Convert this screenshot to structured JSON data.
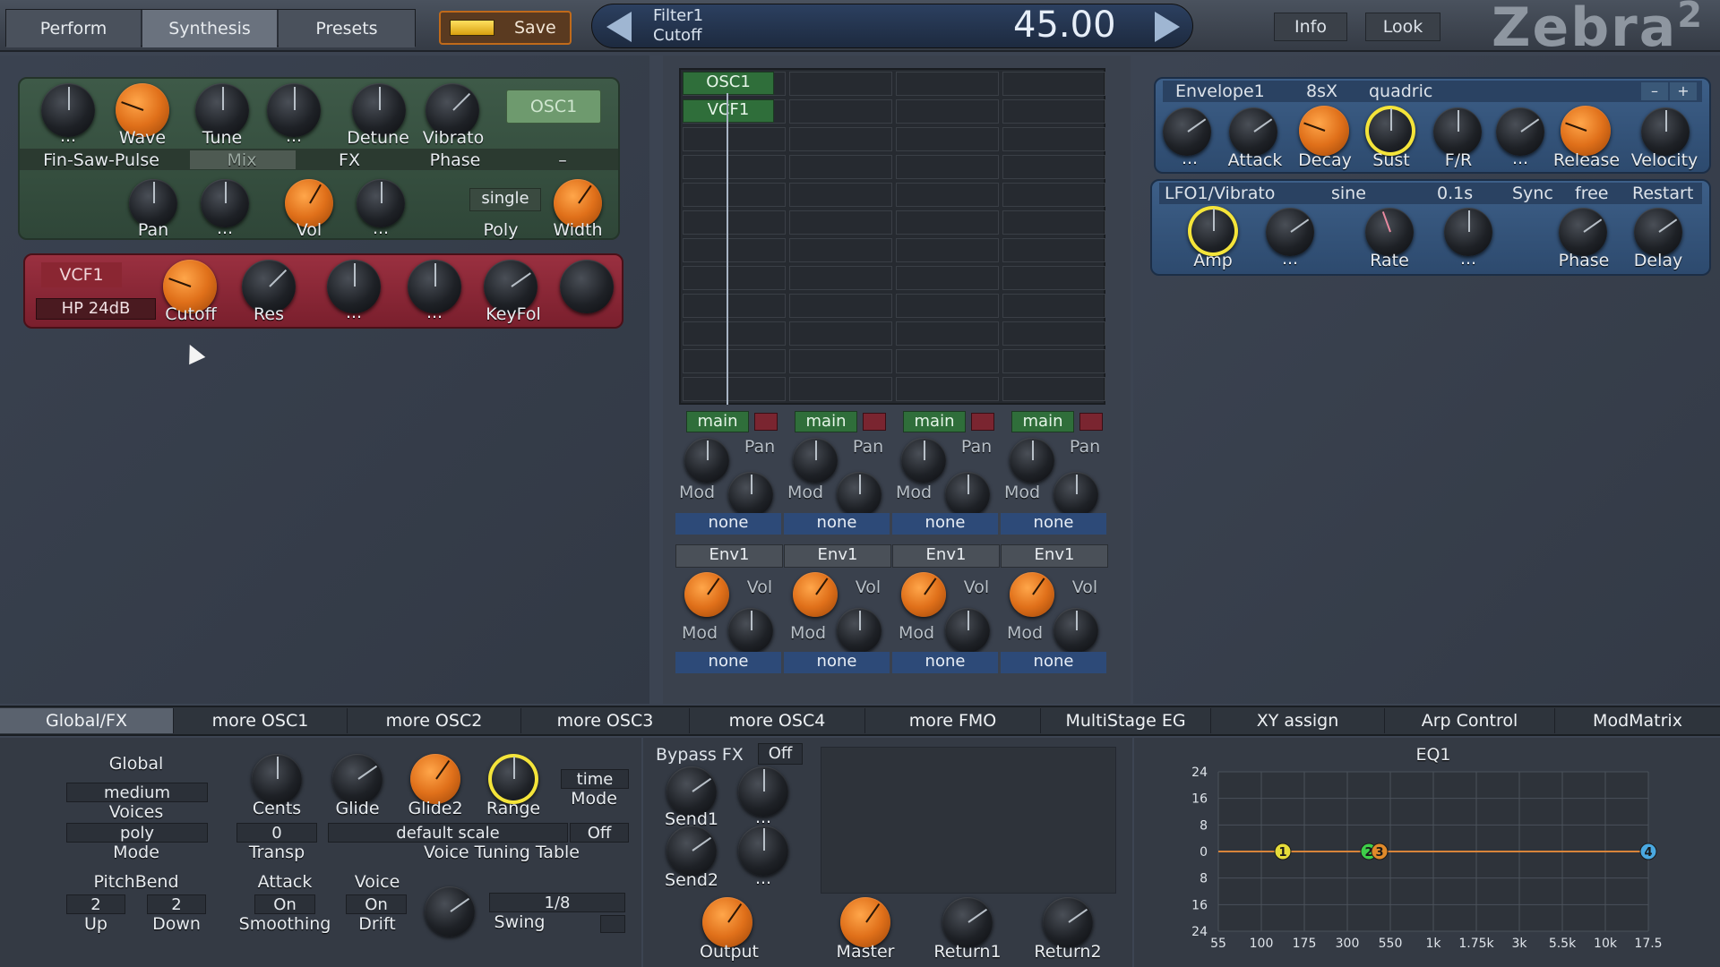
{
  "topbar": {
    "tabs": [
      "Perform",
      "Synthesis",
      "Presets"
    ],
    "save_label": "Save",
    "param_line1": "Filter1",
    "param_line2": "Cutoff",
    "param_value": "45.00",
    "info_label": "Info",
    "look_label": "Look",
    "logo": "Zebra",
    "logo_sup": "2"
  },
  "osc1": {
    "knob_labels": [
      "...",
      "Wave",
      "Tune",
      "...",
      "Detune",
      "Vibrato"
    ],
    "button": "OSC1",
    "row_labels": [
      "Fin-Saw-Pulse",
      "Mix",
      "FX",
      "Phase",
      "–"
    ],
    "bottom_labels": [
      "Pan",
      "...",
      "Vol",
      "...",
      "Poly",
      "Width"
    ],
    "poly_value": "single"
  },
  "vcf1": {
    "name": "VCF1",
    "type": "HP 24dB",
    "knob_labels": [
      "Cutoff",
      "Res",
      "...",
      "...",
      "KeyFol"
    ]
  },
  "grid": {
    "tags": [
      "OSC1",
      "VCF1"
    ],
    "lanes": [
      {
        "out": "main",
        "pan": "Pan",
        "mod": "Mod",
        "src": "none",
        "env": "Env1",
        "vol": "Vol",
        "mod2": "Mod",
        "src2": "none"
      },
      {
        "out": "main",
        "pan": "Pan",
        "mod": "Mod",
        "src": "none",
        "env": "Env1",
        "vol": "Vol",
        "mod2": "Mod",
        "src2": "none"
      },
      {
        "out": "main",
        "pan": "Pan",
        "mod": "Mod",
        "src": "none",
        "env": "Env1",
        "vol": "Vol",
        "mod2": "Mod",
        "src2": "none"
      },
      {
        "out": "main",
        "pan": "Pan",
        "mod": "Mod",
        "src": "none",
        "env": "Env1",
        "vol": "Vol",
        "mod2": "Mod",
        "src2": "none"
      }
    ]
  },
  "envelope": {
    "name": "Envelope1",
    "mode": "8sX",
    "curve": "quadric",
    "minus": "–",
    "plus": "+",
    "knob_labels": [
      "...",
      "Attack",
      "Decay",
      "Sust",
      "F/R",
      "...",
      "Release",
      "Velocity"
    ]
  },
  "lfo": {
    "name": "LFO1/Vibrato",
    "wave": "sine",
    "rate_value": "0.1s",
    "sync": "Sync",
    "free": "free",
    "restart": "Restart",
    "knob_labels": [
      "Amp",
      "...",
      "Rate",
      "...",
      "Phase",
      "Delay"
    ]
  },
  "bottom_tabs": [
    "Global/FX",
    "more OSC1",
    "more OSC2",
    "more OSC3",
    "more OSC4",
    "more FMO",
    "MultiStage EG",
    "XY assign",
    "Arp Control",
    "ModMatrix"
  ],
  "global": {
    "title": "Global",
    "voices_value": "medium",
    "voices_label": "Voices",
    "mode_value": "poly",
    "mode_label": "Mode",
    "knob_labels": [
      "Cents",
      "Glide",
      "Glide2",
      "Range"
    ],
    "time_value": "time",
    "time_label": "Mode",
    "transp_value": "0",
    "transp_label": "Transp",
    "scale_value": "default scale",
    "scale_off": "Off",
    "tuning_label": "Voice Tuning Table",
    "pitchbend_label": "PitchBend",
    "up_value": "2",
    "up_label": "Up",
    "down_value": "2",
    "down_label": "Down",
    "attack_label": "Attack",
    "attack_value": "On",
    "smoothing_label": "Smoothing",
    "voice_label": "Voice",
    "voice_value": "On",
    "drift_label": "Drift",
    "swing_value": "1/8",
    "swing_label": "Swing"
  },
  "fx": {
    "bypass_label": "Bypass FX",
    "bypass_value": "Off",
    "send1": "Send1",
    "send2": "Send2",
    "dots1": "...",
    "dots2": "...",
    "output": "Output",
    "master": "Master",
    "return1": "Return1",
    "return2": "Return2"
  },
  "eq": {
    "title": "EQ1",
    "y_ticks": [
      "24",
      "16",
      "8",
      "0",
      "8",
      "16",
      "24"
    ],
    "x_ticks": [
      "55",
      "100",
      "175",
      "300",
      "550",
      "1k",
      "1.75k",
      "3k",
      "5.5k",
      "10k",
      "17.5"
    ],
    "nodes": [
      {
        "label": "1",
        "freq_index": 1.5,
        "gain": 0,
        "color": "#e6dc3a"
      },
      {
        "label": "2",
        "freq_index": 3.5,
        "gain": 0,
        "color": "#3ecf4a"
      },
      {
        "label": "3",
        "freq_index": 3.75,
        "gain": 0,
        "color": "#e08a2a"
      },
      {
        "label": "4",
        "freq_index": 10,
        "gain": 0,
        "color": "#4aa8e0"
      }
    ]
  },
  "colors": {
    "accent": "#e8781e",
    "ring": "#f4e43a",
    "osc_panel": "#3d5a46",
    "vcf_panel": "#8a2a36",
    "env_panel": "#3a5a80"
  }
}
